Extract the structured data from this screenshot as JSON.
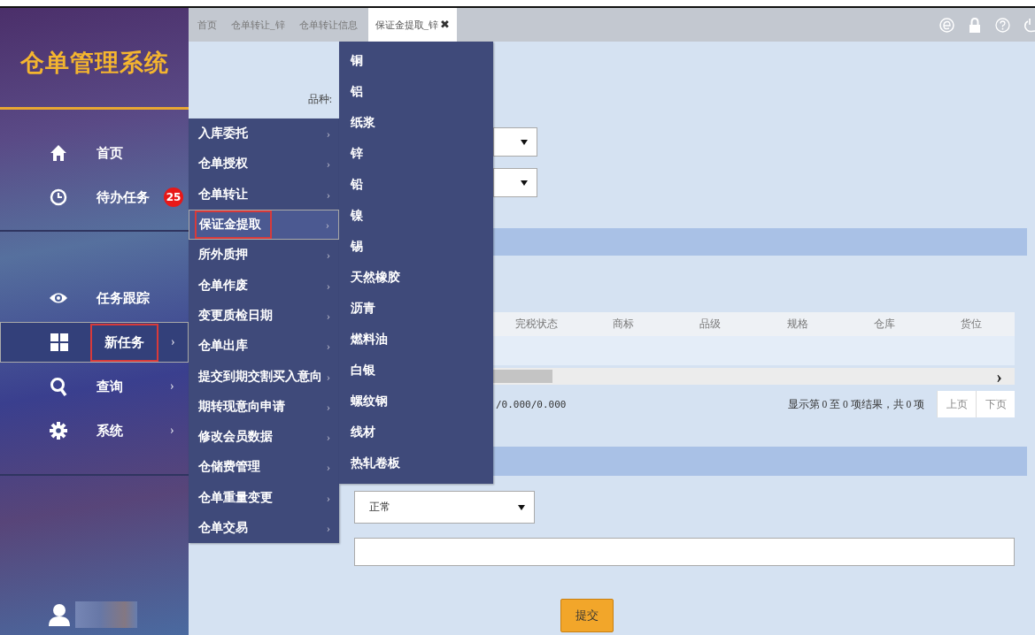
{
  "sidebar": {
    "logo": "仓单管理系统",
    "nav_groups": [
      [
        {
          "label": "首页",
          "submenu": false,
          "selected": false,
          "highlighted": false
        },
        {
          "label": "待办任务",
          "badge": "25",
          "submenu": false,
          "selected": false,
          "highlighted": false
        }
      ],
      [
        {
          "label": "任务跟踪",
          "submenu": false,
          "selected": false,
          "highlighted": false
        },
        {
          "label": "新任务",
          "submenu": true,
          "selected": true,
          "highlighted": true
        },
        {
          "label": "查询",
          "submenu": true,
          "selected": false,
          "highlighted": false
        },
        {
          "label": "系统",
          "submenu": true,
          "selected": false,
          "highlighted": false
        }
      ]
    ],
    "submenu_arrow": "›"
  },
  "tabs": [
    {
      "label": "首页",
      "selected": false
    },
    {
      "label": "仓单转让_锌",
      "selected": false
    },
    {
      "label": "仓单转让信息",
      "selected": false
    },
    {
      "label": "保证金提取_锌",
      "selected": true,
      "close": "✖"
    }
  ],
  "form": {
    "variety_label": "品种:",
    "table": {
      "columns": [
        "完税状态",
        "商标",
        "品级",
        "规格",
        "仓库",
        "货位"
      ],
      "scroll_arrow": "›",
      "totals": "/0.000/0.000",
      "paging_info": "显示第 0 至 0 项结果，共 0 项",
      "prev": "上页",
      "next": "下页"
    },
    "status_select": {
      "value": "正常"
    },
    "submit": "提交"
  },
  "menu": [
    {
      "label": "入库委托",
      "selected": false,
      "highlighted": false
    },
    {
      "label": "仓单授权",
      "selected": false,
      "highlighted": false
    },
    {
      "label": "仓单转让",
      "selected": false,
      "highlighted": false
    },
    {
      "label": "保证金提取",
      "selected": true,
      "highlighted": true
    },
    {
      "label": "所外质押",
      "selected": false,
      "highlighted": false
    },
    {
      "label": "仓单作废",
      "selected": false,
      "highlighted": false
    },
    {
      "label": "变更质检日期",
      "selected": false,
      "highlighted": false
    },
    {
      "label": "仓单出库",
      "selected": false,
      "highlighted": false
    },
    {
      "label": "提交到期交割买入意向",
      "selected": false,
      "highlighted": false
    },
    {
      "label": "期转现意向申请",
      "selected": false,
      "highlighted": false
    },
    {
      "label": "修改会员数据",
      "selected": false,
      "highlighted": false
    },
    {
      "label": "仓储费管理",
      "selected": false,
      "highlighted": false
    },
    {
      "label": "仓单重量变更",
      "selected": false,
      "highlighted": false
    },
    {
      "label": "仓单交易",
      "selected": false,
      "highlighted": false
    }
  ],
  "submenu": [
    "铜",
    "铝",
    "纸浆",
    "锌",
    "铅",
    "镍",
    "锡",
    "天然橡胶",
    "沥青",
    "燃料油",
    "白银",
    "螺纹钢",
    "线材",
    "热轧卷板"
  ]
}
